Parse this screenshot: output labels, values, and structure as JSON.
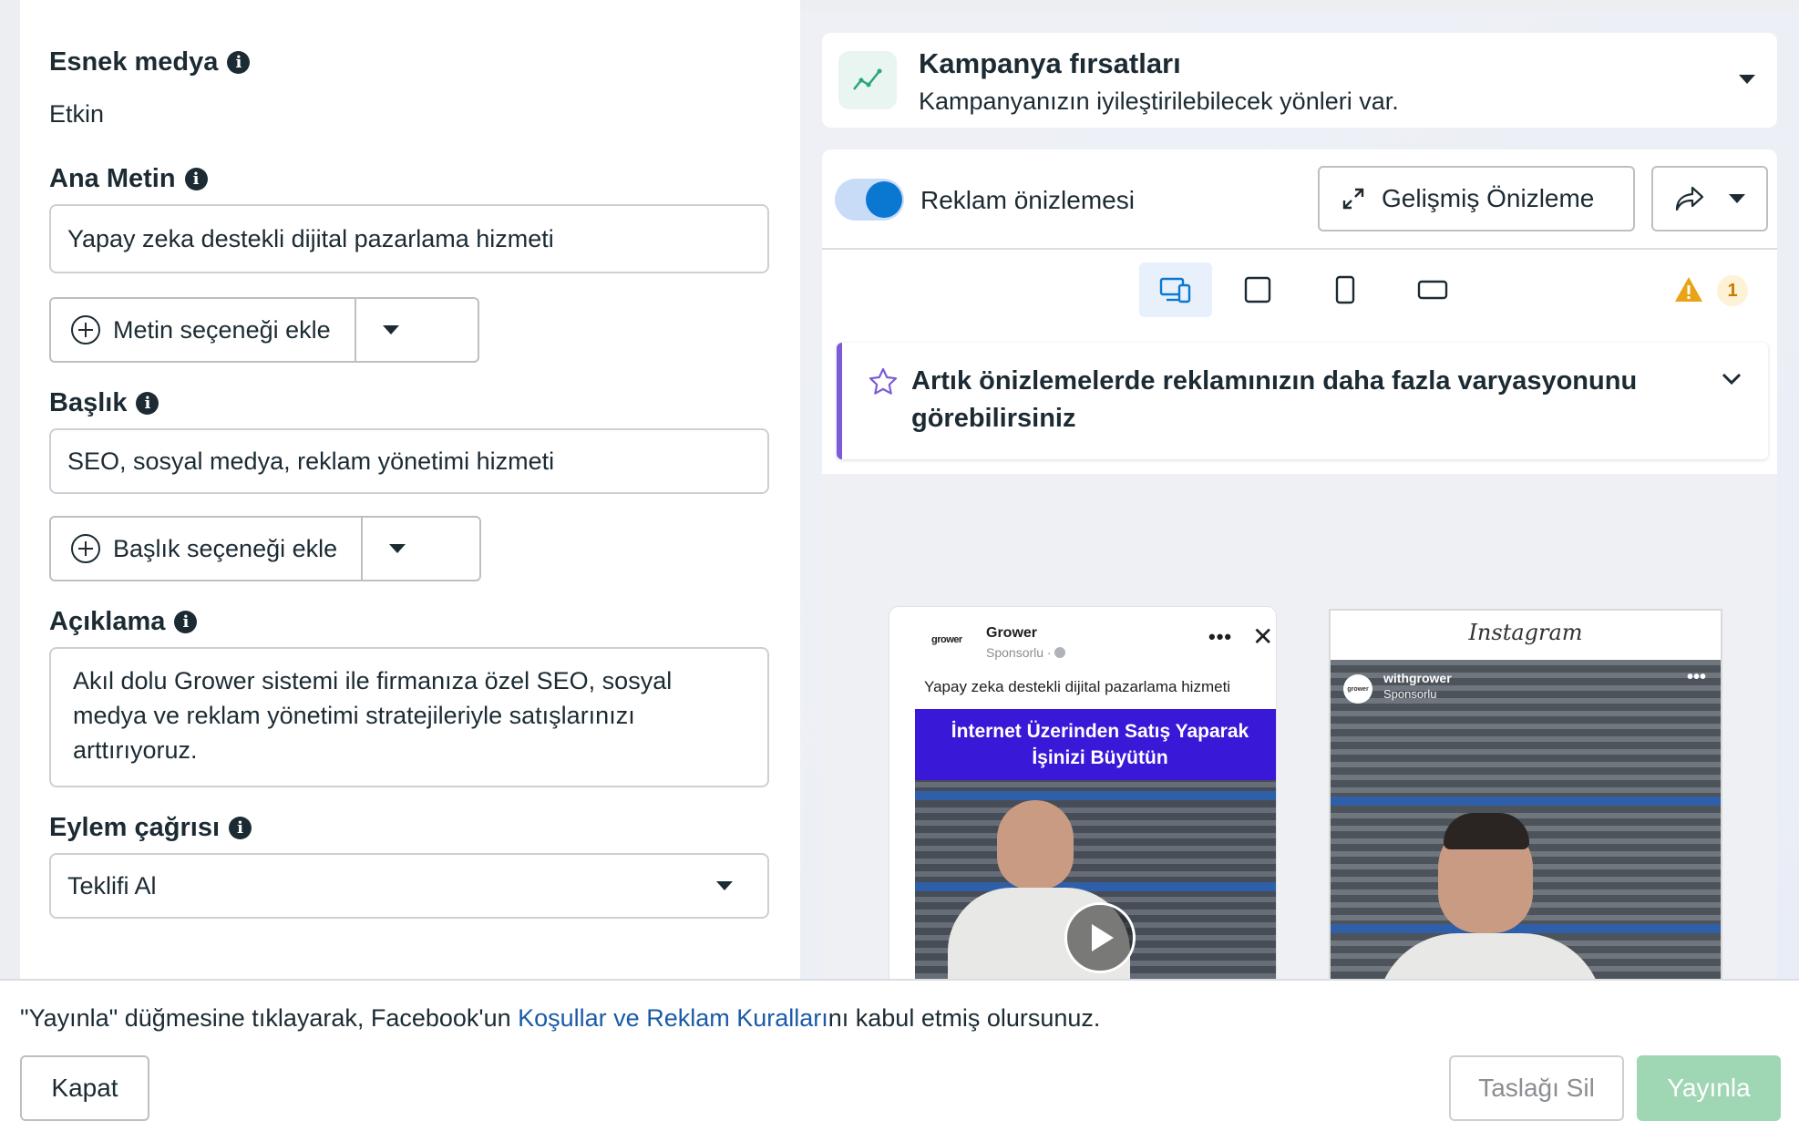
{
  "left": {
    "flexible_media": {
      "label": "Esnek medya",
      "value": "Etkin"
    },
    "primary_text": {
      "label": "Ana Metin",
      "value": "Yapay zeka destekli dijital pazarlama hizmeti",
      "add_option": "Metin seçeneği ekle"
    },
    "headline": {
      "label": "Başlık",
      "value": "SEO, sosyal medya, reklam yönetimi hizmeti",
      "add_option": "Başlık seçeneği ekle"
    },
    "description": {
      "label": "Açıklama",
      "value": "Akıl dolu Grower sistemi ile firmanıza özel SEO, sosyal medya ve reklam yönetimi stratejileriyle satışlarınızı arttırıyoruz."
    },
    "cta": {
      "label": "Eylem çağrısı",
      "value": "Teklifi Al"
    }
  },
  "opportunities": {
    "title": "Kampanya fırsatları",
    "subtitle": "Kampanyanızın iyileştirilebilecek yönleri var."
  },
  "preview": {
    "toggle_label": "Reklam önizlemesi",
    "toggle_on": true,
    "advanced_button": "Gelişmiş Önizleme",
    "warning_count": "1",
    "variations_notice": "Artık önizlemelerde reklamınızın daha fazla varyasyonunu görebilirsiniz"
  },
  "fb_ad": {
    "logo": "grower",
    "page_name": "Grower",
    "sponsored": "Sponsorlu ·",
    "primary_text": "Yapay zeka destekli dijital pazarlama hizmeti",
    "banner_line1": "İnternet Üzerinden Satış Yaparak",
    "banner_line2": "İşinizi Büyütün"
  },
  "ig_ad": {
    "brand": "Instagram",
    "avatar": "grower",
    "account": "withgrower",
    "sponsored": "Sponsorlu"
  },
  "footer": {
    "note_before": "\"Yayınla\" düğmesine tıklayarak, Facebook'un ",
    "note_link": "Koşullar ve Reklam Kuralları",
    "note_after": "nı kabul etmiş olursunuz.",
    "close": "Kapat",
    "delete_draft": "Taslağı Sil",
    "publish": "Yayınla"
  },
  "colors": {
    "accent_blue": "#0a78d1",
    "publish_disabled": "#9fd6b4",
    "notice_border": "#7c5cd6",
    "warning": "#e8a317"
  }
}
